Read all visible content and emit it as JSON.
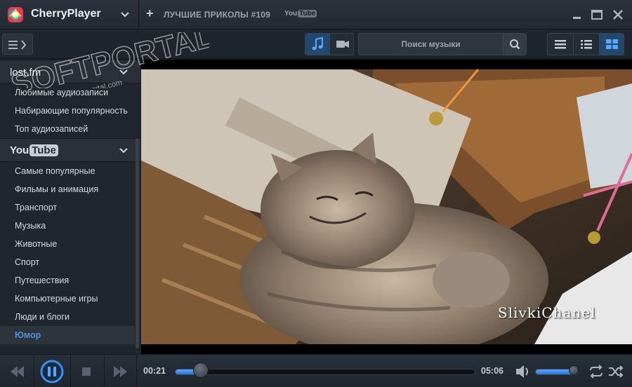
{
  "app": {
    "name": "CherryPlayer",
    "now_playing_title": "ЛУЧШИЕ ПРИКОЛЫ #109",
    "now_playing_source_you": "You",
    "now_playing_source_tube": "Tube"
  },
  "toolbar": {
    "search_placeholder": "Поиск музыки",
    "mode_active": "music",
    "view_active": "grid"
  },
  "sidebar": {
    "lastfm_label": "lost.fm",
    "lastfm_items": [
      {
        "label": "Любимые аудиозаписи"
      },
      {
        "label": "Набирающие популярность"
      },
      {
        "label": "Топ аудиозаписей"
      }
    ],
    "youtube_logo_you": "You",
    "youtube_logo_tube": "Tube",
    "youtube_items": [
      {
        "label": "Самые популярные"
      },
      {
        "label": "Фильмы и анимация"
      },
      {
        "label": "Транспорт"
      },
      {
        "label": "Музыка"
      },
      {
        "label": "Животные"
      },
      {
        "label": "Спорт"
      },
      {
        "label": "Путешествия"
      },
      {
        "label": "Компьютерные игры"
      },
      {
        "label": "Люди и блоги"
      },
      {
        "label": "Юмор"
      }
    ],
    "active_item": "Юмор"
  },
  "watermark": {
    "text": "SOFTPORTAL",
    "url": "www.softportal.com"
  },
  "video": {
    "caption": "SlivkiChanel"
  },
  "player": {
    "elapsed": "00:21",
    "duration": "05:06",
    "progress_fraction": 0.085,
    "volume_fraction": 0.9,
    "accent_color": "#3f8ff0"
  }
}
